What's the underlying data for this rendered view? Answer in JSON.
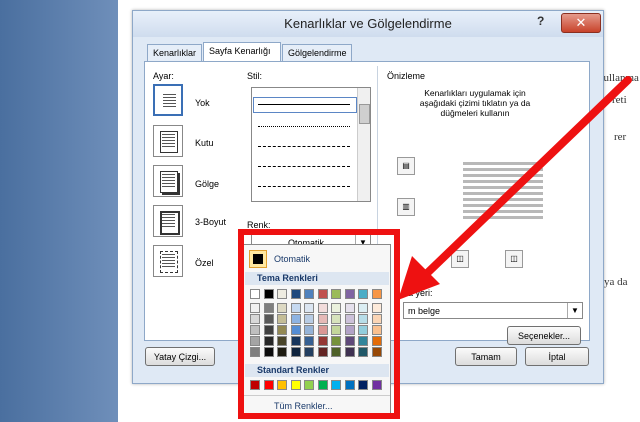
{
  "dialog": {
    "title": "Kenarlıklar ve Gölgelendirme",
    "help": "?",
    "close": "✕"
  },
  "tabs": [
    "Kenarlıklar",
    "Sayfa Kenarlığı",
    "Gölgelendirme"
  ],
  "settings": {
    "label": "Ayar:",
    "items": [
      "Yok",
      "Kutu",
      "Gölge",
      "3-Boyut",
      "Özel"
    ]
  },
  "style": {
    "label": "Stil:"
  },
  "color": {
    "label": "Renk:",
    "value": "Otomatik"
  },
  "preview": {
    "label": "Önizleme",
    "hint": "Kenarlıkları uygulamak için aşağıdaki çizimi tıklatın ya da düğmeleri kullanın"
  },
  "apply": {
    "label": "na yeri:",
    "value": "m belge"
  },
  "buttons": {
    "options": "Seçenekler...",
    "horizontal_line": "Yatay Çizgi...",
    "ok": "Tamam",
    "cancel": "İptal"
  },
  "palette": {
    "automatic": "Otomatik",
    "theme_header": "Tema Renkleri",
    "standard_header": "Standart Renkler",
    "more_colors": "Tüm Renkler...",
    "theme_top": [
      "#ffffff",
      "#000000",
      "#eeece1",
      "#1f497d",
      "#4f81bd",
      "#c0504d",
      "#9bbb59",
      "#8064a2",
      "#4bacc6",
      "#f79646"
    ],
    "theme_shades": [
      [
        "#f2f2f2",
        "#7f7f7f",
        "#ddd9c3",
        "#c6d9f0",
        "#dbe5f1",
        "#f2dcdb",
        "#ebf1dd",
        "#e5e0ec",
        "#dbeef3",
        "#fdeada"
      ],
      [
        "#d8d8d8",
        "#595959",
        "#c4bd97",
        "#8db3e2",
        "#b8cce4",
        "#e5b9b7",
        "#d7e3bc",
        "#ccc1d9",
        "#b7dde8",
        "#fbd5b5"
      ],
      [
        "#bfbfbf",
        "#3f3f3f",
        "#938953",
        "#548dd4",
        "#95b3d7",
        "#d99694",
        "#c3d69b",
        "#b2a2c7",
        "#92cddc",
        "#fac08f"
      ],
      [
        "#a5a5a5",
        "#262626",
        "#494429",
        "#17365d",
        "#366092",
        "#953734",
        "#76923c",
        "#5f497a",
        "#31859b",
        "#e36c09"
      ],
      [
        "#7f7f7f",
        "#0c0c0c",
        "#1d1b10",
        "#0f243e",
        "#244061",
        "#632423",
        "#4f6128",
        "#3f3151",
        "#205867",
        "#974806"
      ]
    ],
    "standard": [
      "#c00000",
      "#ff0000",
      "#ffc000",
      "#ffff00",
      "#92d050",
      "#00b050",
      "#00b0f0",
      "#0070c0",
      "#002060",
      "#7030a0"
    ]
  },
  "document": {
    "lines": [
      "kullanma",
      "reti",
      "rer",
      "ya da"
    ]
  }
}
